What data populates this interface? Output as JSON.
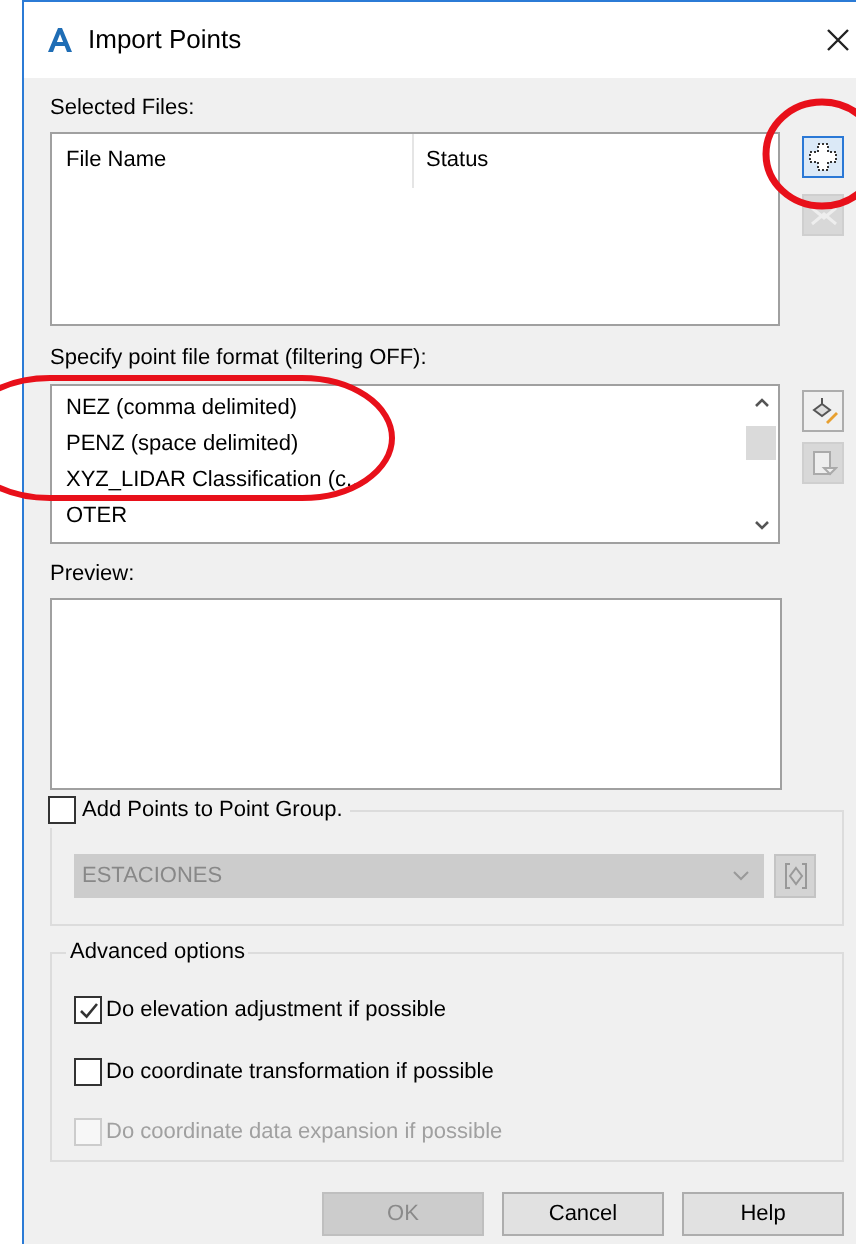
{
  "window": {
    "title": "Import Points"
  },
  "selected_files": {
    "label": "Selected Files:",
    "columns": [
      "File Name",
      "Status"
    ]
  },
  "format": {
    "label": "Specify point file format (filtering OFF):",
    "items": [
      {
        "label": "NEZ (comma delimited)"
      },
      {
        "label": "PENZ (space delimited)"
      },
      {
        "label": "XYZ_LIDAR Classification (c..."
      },
      {
        "label": "OTER"
      }
    ]
  },
  "preview": {
    "label": "Preview:"
  },
  "point_group": {
    "label": "Add Points to Point Group.",
    "checked": false,
    "value": "ESTACIONES",
    "disabled": true
  },
  "advanced": {
    "title": "Advanced options",
    "options": [
      {
        "label": "Do elevation adjustment if possible",
        "checked": true,
        "disabled": false
      },
      {
        "label": "Do coordinate transformation if possible",
        "checked": false,
        "disabled": false
      },
      {
        "label": "Do coordinate data expansion if possible",
        "checked": false,
        "disabled": true
      }
    ]
  },
  "buttons": [
    {
      "label": "OK",
      "disabled": true
    },
    {
      "label": "Cancel",
      "disabled": false
    },
    {
      "label": "Help",
      "disabled": false
    }
  ]
}
